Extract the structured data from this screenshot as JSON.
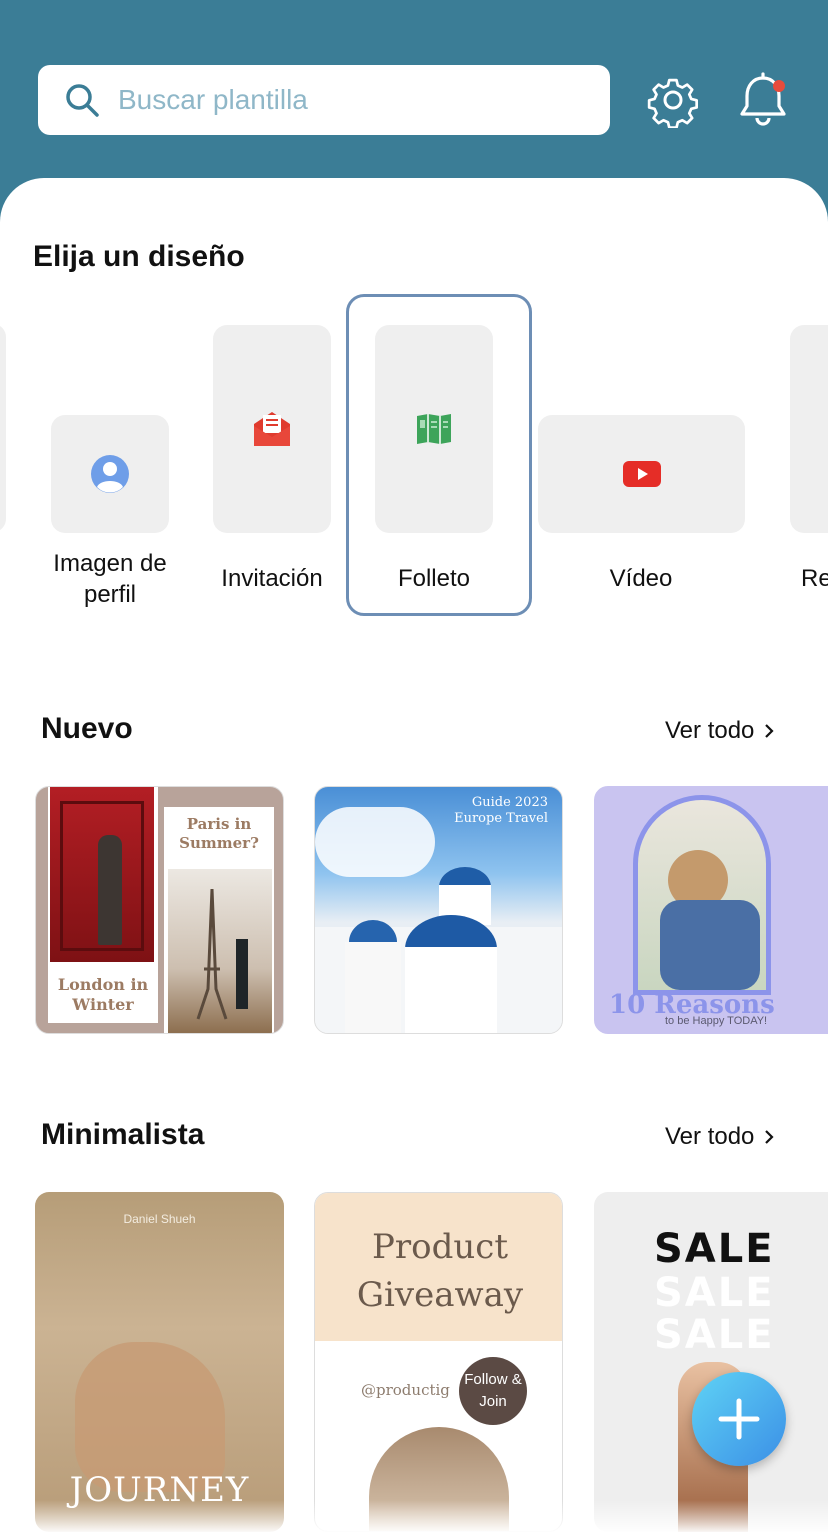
{
  "search": {
    "placeholder": "Buscar plantilla",
    "icon": "search-icon"
  },
  "header": {
    "settings_icon": "gear-icon",
    "notifications_icon": "bell-icon",
    "accent": "#3b7d96"
  },
  "design_section": {
    "title": "Elija un diseño",
    "items": [
      {
        "label": "Imagen de perfil",
        "icon": "profile-icon"
      },
      {
        "label": "Invitación",
        "icon": "invitation-envelope-icon"
      },
      {
        "label": "Folleto",
        "icon": "brochure-icon",
        "selected": true
      },
      {
        "label": "Vídeo",
        "icon": "video-play-icon"
      },
      {
        "label": "Re"
      }
    ]
  },
  "new_section": {
    "title": "Nuevo",
    "see_all": "Ver todo",
    "cards": [
      {
        "left_caption": "London in Winter",
        "right_caption": "Paris in Summer?"
      },
      {
        "caption": "Guide 2023 Europe Travel"
      },
      {
        "title": "10 Reasons",
        "subtitle": "to be Happy TODAY!"
      }
    ]
  },
  "minimal_section": {
    "title": "Minimalista",
    "see_all": "Ver todo",
    "cards": [
      {
        "author": "Daniel Shueh",
        "title": "JOURNEY"
      },
      {
        "title": "Product Giveaway",
        "handle": "@productig",
        "badge": "Follow & Join"
      },
      {
        "title": "SALE"
      }
    ]
  },
  "fab": {
    "icon": "plus-icon"
  }
}
